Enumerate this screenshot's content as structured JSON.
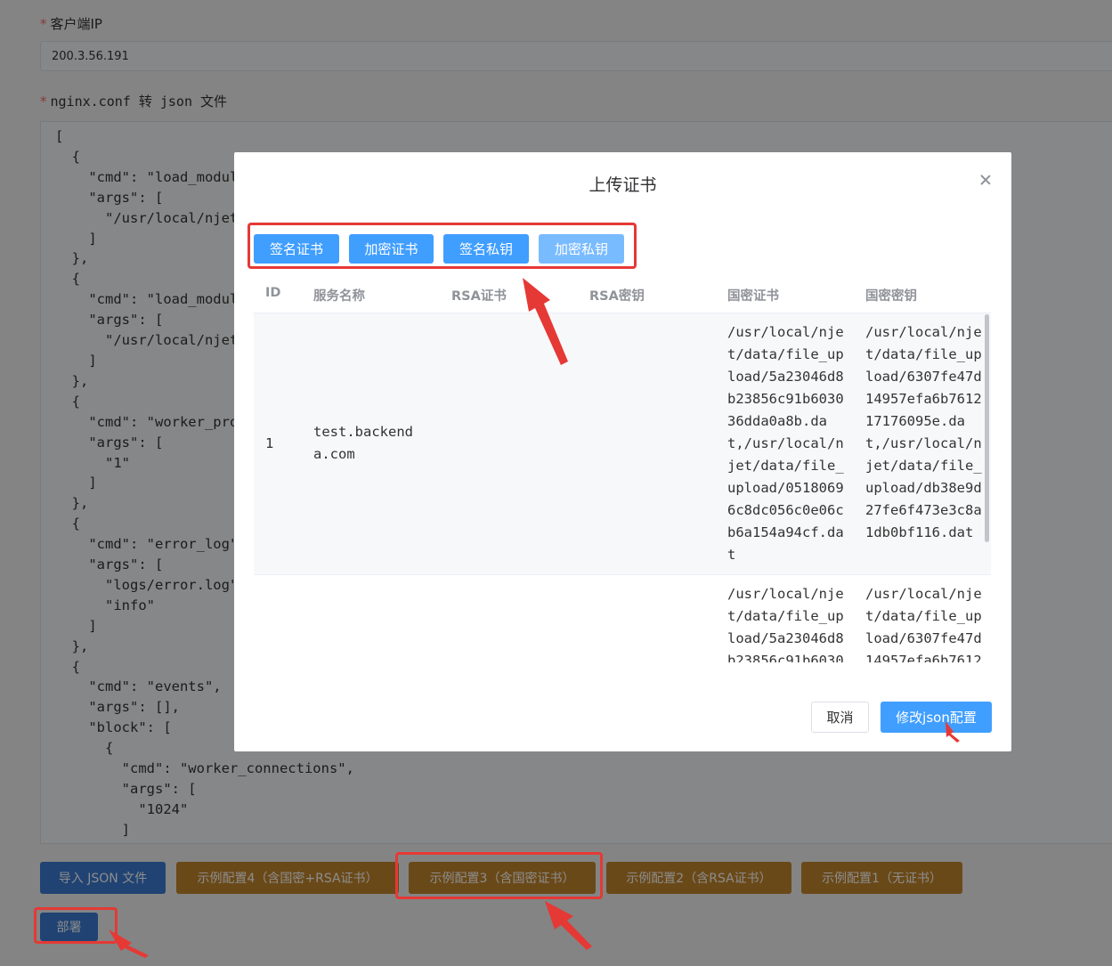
{
  "form": {
    "client_ip_label": "客户端IP",
    "client_ip_value": "200.3.56.191",
    "json_label": "nginx.conf 转 json 文件",
    "json_text": "[\n  {\n    \"cmd\": \"load_module\",\n    \"args\": [\n      \"/usr/local/njet/modules/njt_http_split_clients_2_module.so\"\n    ]\n  },\n  {\n    \"cmd\": \"load_module\",\n    \"args\": [\n      \"/usr/local/njet/modules/njt_agent_dynlog_module.so\"\n    ]\n  },\n  {\n    \"cmd\": \"worker_processes\",\n    \"args\": [\n      \"1\"\n    ]\n  },\n  {\n    \"cmd\": \"error_log\",\n    \"args\": [\n      \"logs/error.log\",\n      \"info\"\n    ]\n  },\n  {\n    \"cmd\": \"events\",\n    \"args\": [],\n    \"block\": [\n      {\n        \"cmd\": \"worker_connections\",\n        \"args\": [\n          \"1024\"\n        ]\n      }\n    ]\n  }\n]"
  },
  "actions": {
    "import": "导入 JSON 文件",
    "example4": "示例配置4（含国密+RSA证书）",
    "example3": "示例配置3（含国密证书）",
    "example2": "示例配置2（含RSA证书）",
    "example1": "示例配置1（无证书）",
    "deploy": "部署"
  },
  "dialog": {
    "title": "上传证书",
    "tabs": [
      "签名证书",
      "加密证书",
      "签名私钥",
      "加密私钥"
    ],
    "columns": [
      "ID",
      "服务名称",
      "RSA证书",
      "RSA密钥",
      "国密证书",
      "国密密钥"
    ],
    "rows": [
      {
        "id": "1",
        "name": "test.backenda.com",
        "rsa_cert": "",
        "rsa_key": "",
        "gm_cert": "/usr/local/njet/data/file_upload/5a23046d8b23856c91b603036dda0a8b.dat,/usr/local/njet/data/file_upload/05180696c8dc056c0e06cb6a154a94cf.dat",
        "gm_key": "/usr/local/njet/data/file_upload/6307fe47d14957efa6b761217176095e.dat,/usr/local/njet/data/file_upload/db38e9d27fe6f473e3c8a1db0bf116.dat"
      },
      {
        "id": "",
        "name": "",
        "rsa_cert": "",
        "rsa_key": "",
        "gm_cert": "/usr/local/njet/data/file_upload/5a23046d8b23856c91b6030",
        "gm_key": "/usr/local/njet/data/file_upload/6307fe47d14957efa6b7612"
      }
    ],
    "cancel": "取消",
    "confirm": "修改json配置"
  },
  "colors": {
    "primary": "#409eff",
    "primary_light": "#79bbff",
    "import_button": "#3b7bd1",
    "example_button": "#c2852c",
    "annotation_red": "#e53935",
    "required_star": "#f56c6c"
  }
}
